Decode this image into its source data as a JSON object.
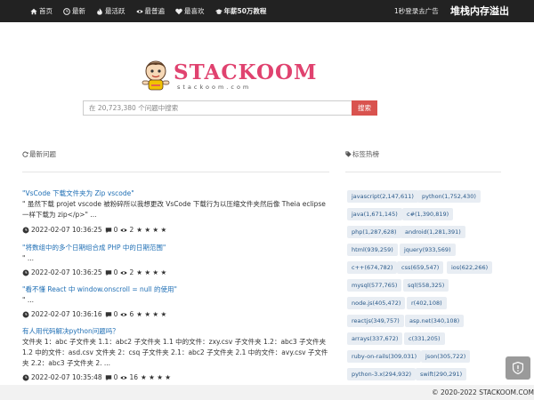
{
  "nav": {
    "items": [
      {
        "label": "首页",
        "icon": "home-icon"
      },
      {
        "label": "最新",
        "icon": "clock-icon"
      },
      {
        "label": "最活跃",
        "icon": "fire-icon"
      },
      {
        "label": "最普遍",
        "icon": "eye-icon"
      },
      {
        "label": "最喜欢",
        "icon": "heart-icon"
      },
      {
        "label": "年薪50万教程",
        "icon": "graduation-cap-icon"
      }
    ],
    "login_ad": "1秒登录去广告",
    "overflow_brand": "堆栈内存溢出"
  },
  "logo": {
    "title": "STACKOOM",
    "subtitle": "stackoom.com"
  },
  "search": {
    "placeholder": "在 20,723,380 个问题中搜索",
    "button": "搜索"
  },
  "questions_header": "最新问题",
  "tags_header": "标签热榜",
  "questions": [
    {
      "title": "\"VsCode 下载文件夹为 Zip vscode\"",
      "excerpt": "\" 虽然下载 projet vscode 被粉碎所以我想更改 VsCode 下载行为以压缩文件夹然后像 Theia eclipse 一样下载为 zip</p>\" ...",
      "date": "2022-02-07 10:36:25",
      "answers": "0",
      "views": "2",
      "stars": "★ ★ ★ ★"
    },
    {
      "title": "\"将数组中的多个日期组合成 PHP 中的日期范围\"",
      "excerpt": "\" ...",
      "date": "2022-02-07 10:36:25",
      "answers": "0",
      "views": "2",
      "stars": "★ ★ ★ ★"
    },
    {
      "title": "\"看不懂 React 中 window.onscroll = null 的使用\"",
      "excerpt": "\" ...",
      "date": "2022-02-07 10:36:16",
      "answers": "0",
      "views": "6",
      "stars": "★ ★ ★ ★"
    },
    {
      "title": "有人用代码解决python问题吗？",
      "excerpt": "文件夹 1：abc 子文件夹 1.1：abc2 子文件夹 1.1 中的文件：zxy.csv 子文件夹 1.2：abc3 子文件夹 1.2 中的文件：asd.csv 文件夹 2：csq 子文件夹 2.1：abc2 子文件夹 2.1 中的文件：avy.csv 子文件夹 2.2：abc3 子文件夹 2. ...",
      "date": "2022-02-07 10:35:48",
      "answers": "0",
      "views": "16",
      "stars": "★ ★ ★ ★"
    }
  ],
  "tags": [
    "javascript(2,147,611)",
    "python(1,752,430)",
    "java(1,671,145)",
    "c#(1,390,819)",
    "php(1,287,628)",
    "android(1,281,391)",
    "html(939,259)",
    "jquery(933,569)",
    "c++(674,782)",
    "css(659,547)",
    "ios(622,266)",
    "mysql(577,765)",
    "sql(558,325)",
    "node.js(405,472)",
    "r(402,108)",
    "reactjs(349,757)",
    "asp.net(340,108)",
    "arrays(337,672)",
    "c(331,205)",
    "ruby-on-rails(309,031)",
    "json(305,722)",
    "python-3.x(294,932)",
    "swift(290,291)"
  ],
  "footer": "© 2020-2022 STACKOOM.COM",
  "colors": {
    "navbar": "#222222",
    "brand_pink": "#e0426f",
    "link_blue": "#1f6fb5",
    "search_button": "#d9534f",
    "tag_bg": "#e8edf3"
  }
}
